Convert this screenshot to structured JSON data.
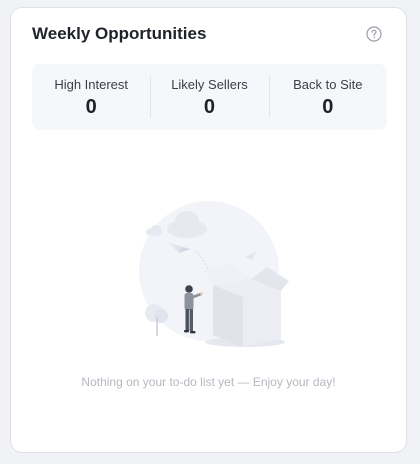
{
  "card": {
    "title": "Weekly Opportunities",
    "help_icon": "question-circle-icon"
  },
  "stats": [
    {
      "label": "High Interest",
      "value": "0"
    },
    {
      "label": "Likely Sellers",
      "value": "0"
    },
    {
      "label": "Back to Site",
      "value": "0"
    }
  ],
  "empty_state": {
    "message": "Nothing on your to-do list yet — Enjoy your day!",
    "illustration": "empty-box-illustration"
  },
  "colors": {
    "title": "#1f2329",
    "stats_background": "#f6f7fb",
    "muted_text": "#b5b8bf",
    "card_border": "#dfe1e6"
  }
}
